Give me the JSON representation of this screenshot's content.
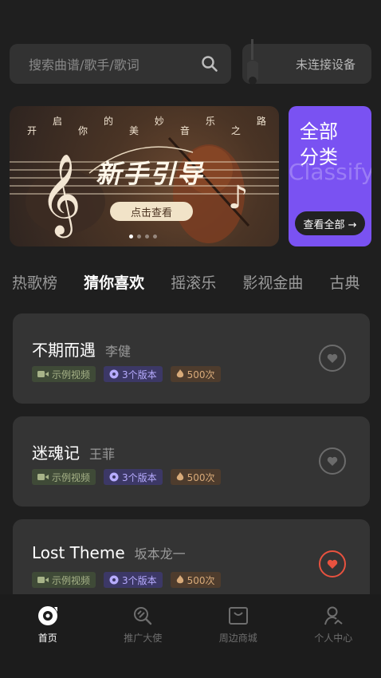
{
  "search": {
    "placeholder": "搜索曲谱/歌手/歌词"
  },
  "device": {
    "status": "未连接设备"
  },
  "banner": {
    "tagline": [
      "开",
      "启",
      "你",
      "的",
      "美",
      "妙",
      "音",
      "乐",
      "之",
      "路"
    ],
    "title": "新手引导",
    "cta": "点击查看"
  },
  "classify": {
    "title": "全部分类",
    "en": "Classify",
    "button": "查看全部 →"
  },
  "tabs": [
    "热歌榜",
    "猜你喜欢",
    "摇滚乐",
    "影视金曲",
    "古典"
  ],
  "songs": [
    {
      "title": "不期而遇",
      "artist": "李健",
      "video": "示例视频",
      "versions": "3个版本",
      "plays": "500次",
      "liked": false
    },
    {
      "title": "迷魂记",
      "artist": "王菲",
      "video": "示例视频",
      "versions": "3个版本",
      "plays": "500次",
      "liked": false
    },
    {
      "title": "Lost Theme",
      "artist": "坂本龙一",
      "video": "示例视频",
      "versions": "3个版本",
      "plays": "500次",
      "liked": true
    }
  ],
  "nav": [
    {
      "label": "首页",
      "icon": "home-disc-icon",
      "active": true
    },
    {
      "label": "推广大使",
      "icon": "promo-icon",
      "active": false
    },
    {
      "label": "周边商城",
      "icon": "shop-icon",
      "active": false
    },
    {
      "label": "个人中心",
      "icon": "profile-icon",
      "active": false
    }
  ],
  "colors": {
    "accent": "#7a52f2",
    "like": "#e8523f",
    "background": "#1f1f1f"
  }
}
